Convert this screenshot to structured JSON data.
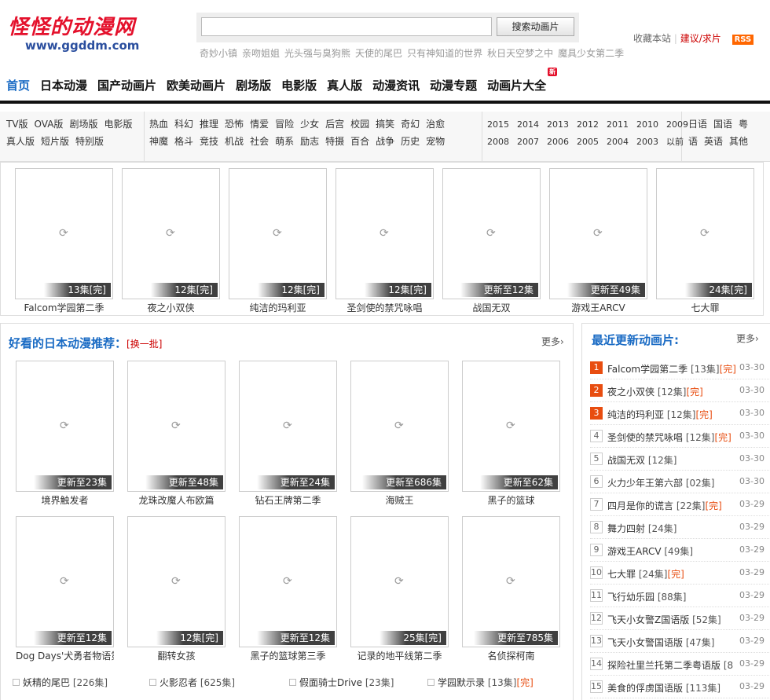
{
  "header": {
    "logo_cn": "怪怪的动漫网",
    "logo_url": "www.ggddm.com",
    "search_placeholder": "",
    "search_button": "搜索动画片",
    "hotwords": [
      "奇妙小镇",
      "亲吻姐姐",
      "光头强与臭狗熊",
      "天使的尾巴",
      "只有神知道的世界",
      "秋日天空梦之中",
      "魔具少女第二季"
    ],
    "fav": "收藏本站",
    "suggest": "建议/求片",
    "rss": "RSS"
  },
  "nav": {
    "items": [
      "首页",
      "日本动漫",
      "国产动画片",
      "欧美动画片",
      "剧场版",
      "电影版",
      "真人版",
      "动漫资讯",
      "动漫专题",
      "动画片大全"
    ],
    "new_badge": "新"
  },
  "categories": {
    "col1": [
      [
        "TV版",
        "OVA版",
        "剧场版",
        "电影版"
      ],
      [
        "真人版",
        "短片版",
        "特别版"
      ]
    ],
    "col2": [
      [
        "热血",
        "科幻",
        "推理",
        "恐怖",
        "情爱",
        "冒险",
        "少女",
        "后宫",
        "校园",
        "搞笑",
        "奇幻",
        "治愈"
      ],
      [
        "神魔",
        "格斗",
        "竞技",
        "机战",
        "社会",
        "萌系",
        "励志",
        "特摄",
        "百合",
        "战争",
        "历史",
        "宠物"
      ]
    ],
    "col3": [
      [
        "2015",
        "2014",
        "2013",
        "2012",
        "2011",
        "2010",
        "2009"
      ],
      [
        "2008",
        "2007",
        "2006",
        "2005",
        "2004",
        "2003",
        "以前"
      ]
    ],
    "col4": [
      [
        "日语",
        "国语",
        "粤"
      ],
      [
        "语",
        "英语",
        "其他"
      ]
    ]
  },
  "hot": [
    {
      "name": "Falcom学园第二季",
      "tag": "13集",
      "fin": "[完]"
    },
    {
      "name": "夜之小双侠",
      "tag": "12集",
      "fin": "[完]"
    },
    {
      "name": "纯洁的玛利亚",
      "tag": "12集",
      "fin": "[完]"
    },
    {
      "name": "圣剑使的禁咒咏唱",
      "tag": "12集",
      "fin": "[完]"
    },
    {
      "name": "战国无双",
      "tag": "更新至12集",
      "fin": ""
    },
    {
      "name": "游戏王ARCV",
      "tag": "更新至49集",
      "fin": ""
    },
    {
      "name": "七大罪",
      "tag": "24集",
      "fin": "[完]"
    }
  ],
  "recommend": {
    "title": "好看的日本动漫推荐：",
    "swap": "[换一批]",
    "more": "更多",
    "items": [
      {
        "name": "境界触发者",
        "tag": "更新至23集",
        "fin": ""
      },
      {
        "name": "龙珠改魔人布欧篇",
        "tag": "更新至48集",
        "fin": ""
      },
      {
        "name": "钻石王牌第二季",
        "tag": "更新至24集",
        "fin": ""
      },
      {
        "name": "海贼王",
        "tag": "更新至686集",
        "fin": ""
      },
      {
        "name": "黑子的篮球",
        "tag": "更新至62集",
        "fin": ""
      },
      {
        "name": "Dog Days'犬勇者物语第三季",
        "tag": "更新至12集",
        "fin": ""
      },
      {
        "name": "翻转女孩",
        "tag": "12集",
        "fin": "[完]"
      },
      {
        "name": "黑子的篮球第三季",
        "tag": "更新至12集",
        "fin": ""
      },
      {
        "name": "记录的地平线第二季",
        "tag": "25集",
        "fin": "[完]"
      },
      {
        "name": "名侦探柯南",
        "tag": "更新至785集",
        "fin": ""
      }
    ],
    "textlist": [
      {
        "name": "妖精的尾巴",
        "ep": "[226集]",
        "fin": ""
      },
      {
        "name": "火影忍者",
        "ep": "[625集]",
        "fin": ""
      },
      {
        "name": "假面骑士Drive",
        "ep": "[23集]",
        "fin": ""
      },
      {
        "name": "学园默示录",
        "ep": "[13集]",
        "fin": "[完]"
      }
    ]
  },
  "latest": {
    "title": "最近更新动画片:",
    "more": "更多",
    "items": [
      {
        "n": "1",
        "name": "Falcom学园第二季",
        "ep": "[13集]",
        "fin": "[完]",
        "date": "03-30"
      },
      {
        "n": "2",
        "name": "夜之小双侠",
        "ep": "[12集]",
        "fin": "[完]",
        "date": "03-30"
      },
      {
        "n": "3",
        "name": "纯洁的玛利亚",
        "ep": "[12集]",
        "fin": "[完]",
        "date": "03-30"
      },
      {
        "n": "4",
        "name": "圣剑使的禁咒咏唱",
        "ep": "[12集]",
        "fin": "[完]",
        "date": "03-30"
      },
      {
        "n": "5",
        "name": "战国无双",
        "ep": "[12集]",
        "fin": "",
        "date": "03-30"
      },
      {
        "n": "6",
        "name": "火力少年王第六部",
        "ep": "[02集]",
        "fin": "",
        "date": "03-30"
      },
      {
        "n": "7",
        "name": "四月是你的谎言",
        "ep": "[22集]",
        "fin": "[完]",
        "date": "03-29"
      },
      {
        "n": "8",
        "name": "舞力四射",
        "ep": "[24集]",
        "fin": "",
        "date": "03-29"
      },
      {
        "n": "9",
        "name": "游戏王ARCV",
        "ep": "[49集]",
        "fin": "",
        "date": "03-29"
      },
      {
        "n": "10",
        "name": "七大罪",
        "ep": "[24集]",
        "fin": "[完]",
        "date": "03-29"
      },
      {
        "n": "11",
        "name": "飞行幼乐园",
        "ep": "[88集]",
        "fin": "",
        "date": "03-29"
      },
      {
        "n": "12",
        "name": "飞天小女警Z国语版",
        "ep": "[52集]",
        "fin": "",
        "date": "03-29"
      },
      {
        "n": "13",
        "name": "飞天小女警国语版",
        "ep": "[47集]",
        "fin": "",
        "date": "03-29"
      },
      {
        "n": "14",
        "name": "探险社里兰托第二季粤语版",
        "ep": "[8",
        "fin": "",
        "date": "03-29"
      },
      {
        "n": "15",
        "name": "美食的俘虏国语版",
        "ep": "[113集]",
        "fin": "",
        "date": "03-29"
      }
    ]
  },
  "icons": {
    "spinner": "loading-icon",
    "arrow": "chevron-right-icon"
  }
}
